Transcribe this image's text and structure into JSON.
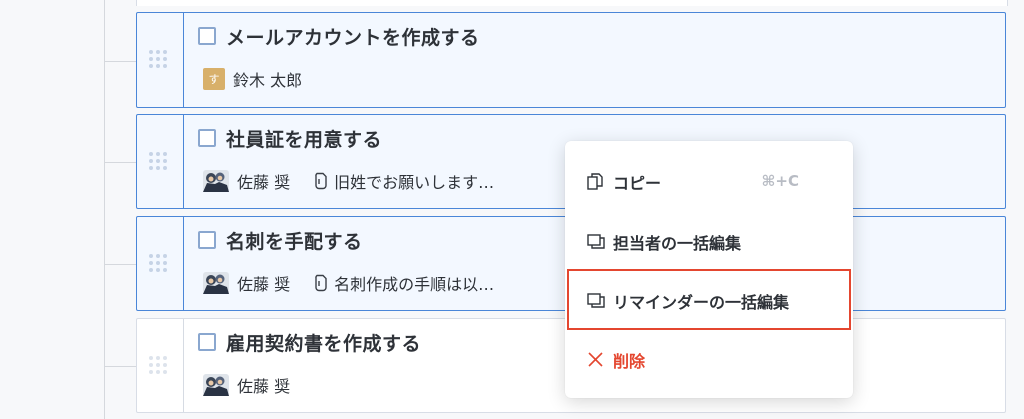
{
  "tasks": [
    {
      "title": "メールアカウントを作成する",
      "assignee": "鈴木 太郎",
      "avatar_letter": "す",
      "note": ""
    },
    {
      "title": "社員証を用意する",
      "assignee": "佐藤 奨",
      "note": "旧姓でお願いします…"
    },
    {
      "title": "名刺を手配する",
      "assignee": "佐藤 奨",
      "note": "名刺作成の手順は以…"
    },
    {
      "title": "雇用契約書を作成する",
      "assignee": "佐藤 奨",
      "note": ""
    }
  ],
  "menu": {
    "copy": "コピー",
    "copy_shortcut": "⌘+C",
    "bulk_assignee": "担当者の一括編集",
    "bulk_reminder": "リマインダーの一括編集",
    "delete": "削除"
  },
  "colors": {
    "selection_border": "#4a86d8",
    "highlight": "#e4462f",
    "avatar_letter_bg": "#d8b06a"
  }
}
